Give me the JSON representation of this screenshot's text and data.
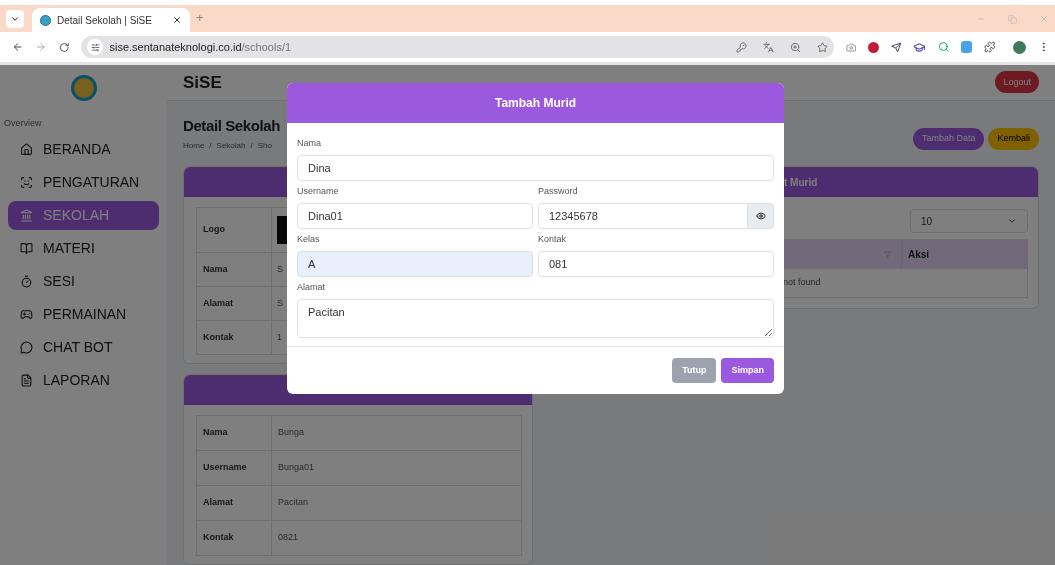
{
  "browser": {
    "tab_title": "Detail Sekolah | SiSE",
    "new_tab": "+",
    "url_host": "sise.sentanateknologi.co.id",
    "url_path": "/schools/1"
  },
  "header": {
    "brand": "SiSE",
    "logout": "Logout"
  },
  "sidebar": {
    "section": "Overview",
    "items": [
      {
        "label": "BERANDA",
        "selected": false
      },
      {
        "label": "PENGATURAN",
        "selected": false
      },
      {
        "label": "SEKOLAH",
        "selected": true
      },
      {
        "label": "MATERI",
        "selected": false
      },
      {
        "label": "SESI",
        "selected": false
      },
      {
        "label": "PERMAINAN",
        "selected": false
      },
      {
        "label": "CHAT BOT",
        "selected": false
      },
      {
        "label": "LAPORAN",
        "selected": false
      }
    ]
  },
  "page": {
    "title": "Detail Sekolah",
    "breadcrumb": [
      "Home",
      "Sekolah",
      "Sho"
    ],
    "separator": "/",
    "actions": [
      {
        "label": "Tambah Data",
        "kind": "primary"
      },
      {
        "label": "Kembali",
        "kind": "warning"
      }
    ]
  },
  "school_table": {
    "rows": [
      {
        "label": "Logo",
        "kind": "image"
      },
      {
        "label": "Nama",
        "value": "S",
        "kind": "text"
      },
      {
        "label": "Alamat",
        "value": "S",
        "kind": "text"
      },
      {
        "label": "Kontak",
        "value": "1",
        "kind": "text"
      }
    ]
  },
  "user_table": {
    "rows": [
      {
        "label": "Nama",
        "value": "Bunga"
      },
      {
        "label": "Username",
        "value": "Bunga01"
      },
      {
        "label": "Alamat",
        "value": "Pacitan"
      },
      {
        "label": "Kontak",
        "value": "0821"
      }
    ]
  },
  "students_card": {
    "title": "t Murid",
    "page_size": "10",
    "column_2": "Aksi",
    "empty": "not found"
  },
  "modal": {
    "title": "Tambah Murid",
    "fields": [
      {
        "label": "Nama",
        "value": "Dina",
        "kind": "text",
        "autofilled": false
      },
      {
        "label": "Username",
        "value": "Dina01",
        "kind": "text",
        "autofilled": false
      },
      {
        "label": "Password",
        "value": "12345678",
        "kind": "password",
        "autofilled": false
      },
      {
        "label": "Kelas",
        "value": "A",
        "kind": "text",
        "autofilled": true
      },
      {
        "label": "Kontak",
        "value": "081",
        "kind": "text",
        "autofilled": false
      },
      {
        "label": "Alamat",
        "value": "Pacitan",
        "kind": "textarea",
        "autofilled": false
      }
    ],
    "buttons": [
      {
        "label": "Tutup",
        "kind": "secondary"
      },
      {
        "label": "Simpan",
        "kind": "primary"
      }
    ]
  }
}
